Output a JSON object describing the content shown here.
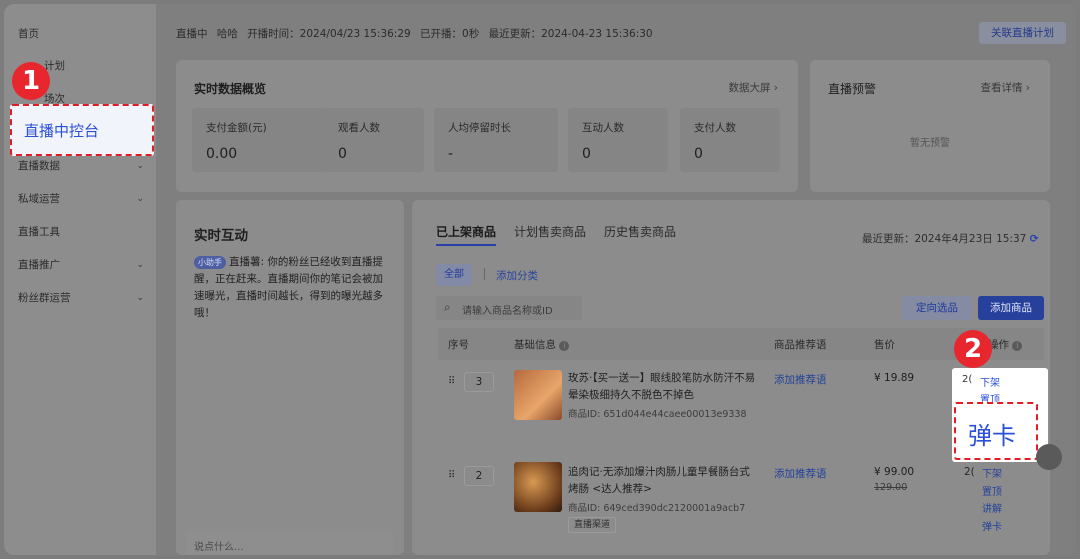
{
  "sidebar": {
    "items": [
      {
        "label": "首页"
      },
      {
        "label": "计划"
      },
      {
        "label": "场次"
      },
      {
        "label": "直播数据"
      },
      {
        "label": "私域运营"
      },
      {
        "label": "直播工具"
      },
      {
        "label": "直播推广"
      },
      {
        "label": "粉丝群运营"
      }
    ],
    "highlight_label": "直播中控台"
  },
  "topbar": {
    "status": "直播中",
    "host": "哈哈",
    "start_time": "开播时间：2024/04/23 15:36:29",
    "elapsed": "已开播：0秒",
    "updated": "最近更新：2024-04-23 15:36:30",
    "link_plan": "关联直播计划"
  },
  "overview": {
    "title": "实时数据概览",
    "big_screen": "数据大屏 ›",
    "stats": [
      {
        "label": "支付金额(元)",
        "value": "0.00"
      },
      {
        "label": "观看人数",
        "value": "0"
      },
      {
        "label": "人均停留时长",
        "value": "-"
      },
      {
        "label": "互动人数",
        "value": "0"
      },
      {
        "label": "支付人数",
        "value": "0"
      }
    ]
  },
  "warning": {
    "title": "直播预警",
    "detail": "查看详情 ›",
    "empty": "暂无预警"
  },
  "interaction": {
    "title": "实时互动",
    "assistant_badge": "小助手",
    "message": "直播薯: 你的粉丝已经收到直播提醒，正在赶来。直播期间你的笔记会被加速曝光，直播时间越长，得到的曝光越多哦！",
    "input_placeholder": "说点什么..."
  },
  "products": {
    "tabs": [
      "已上架商品",
      "计划售卖商品",
      "历史售卖商品"
    ],
    "last_update": "最近更新：2024年4月23日 15:37",
    "filter_all": "全部",
    "filter_add": "添加分类",
    "search_placeholder": "请输入商品名称或ID",
    "btn_select": "定向选品",
    "btn_add": "添加商品",
    "columns": [
      "序号",
      "基础信息",
      "商品推荐语",
      "售价",
      "操作"
    ],
    "rows": [
      {
        "seq": "3",
        "title": "玫苏·【买一送一】眼线胶笔防水防汗不易晕染极细持久不脱色不掉色",
        "id": "商品ID: 651d044e44caee00013e9338",
        "recommend": "添加推荐语",
        "price": "¥ 19.89",
        "old_price": "",
        "ops": [
          "下架",
          "置顶"
        ]
      },
      {
        "seq": "2",
        "title": "追肉记·无添加爆汁肉肠儿童早餐肠台式烤肠 <达人推荐>",
        "id": "商品ID: 649ced390dc2120001a9acb7",
        "tag": "直播渠道",
        "recommend": "添加推荐语",
        "price": "¥ 99.00",
        "old_price": "129.00",
        "ops": [
          "下架",
          "置顶",
          "讲解",
          "弹卡"
        ]
      }
    ]
  },
  "annotations": {
    "badge1": "1",
    "badge2": "2",
    "callout": "弹卡"
  }
}
